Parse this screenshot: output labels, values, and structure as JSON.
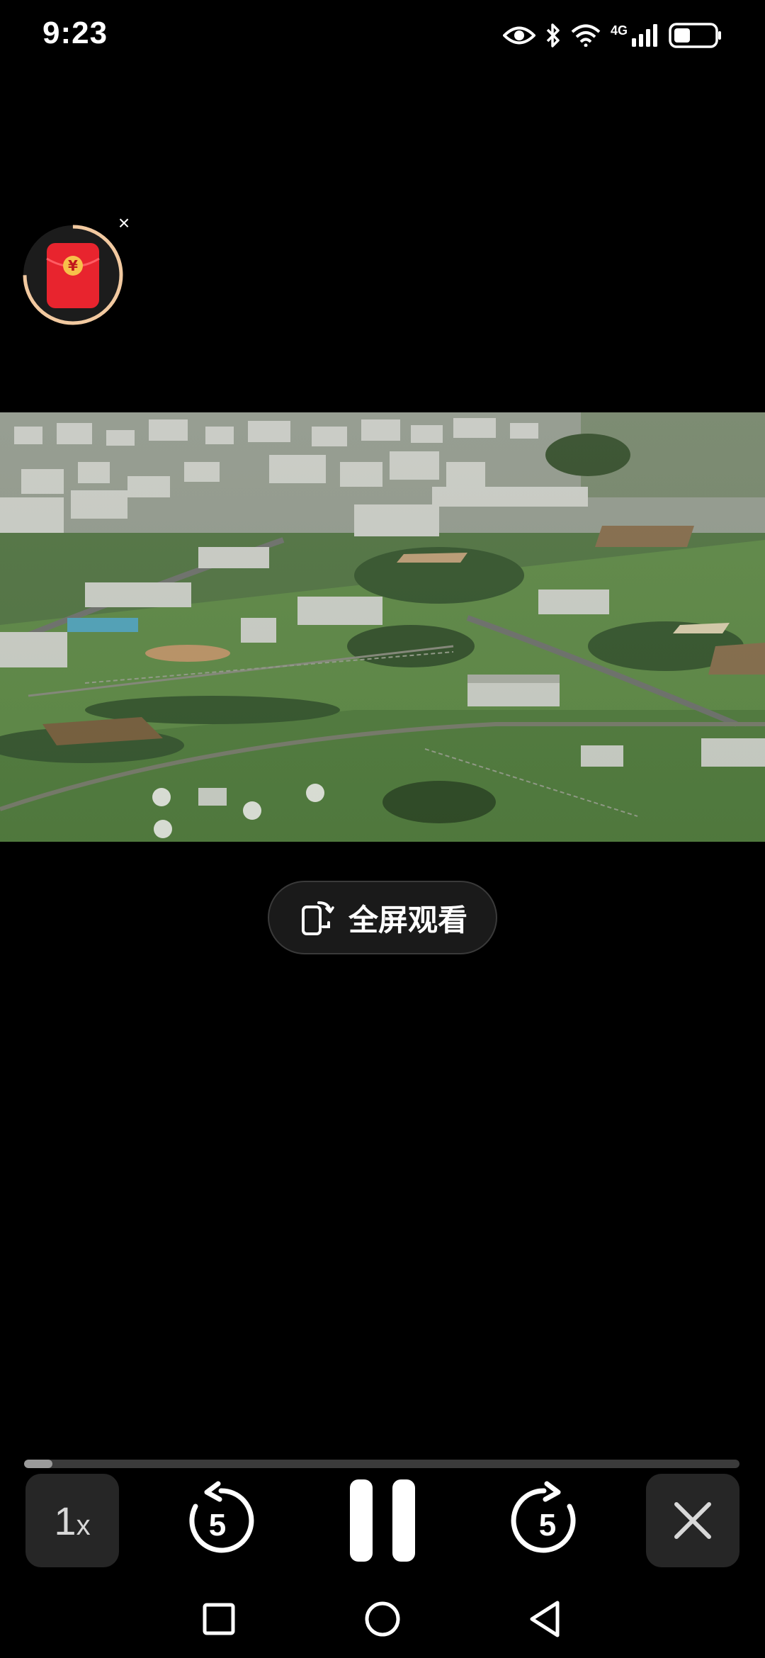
{
  "status_bar": {
    "time": "9:23",
    "network": "4G",
    "icons": [
      "eye-icon",
      "bluetooth-icon",
      "wifi-icon",
      "signal-icon",
      "battery-icon"
    ],
    "battery_level": 0.4
  },
  "widget": {
    "red_packet_icon": "red-envelope-icon",
    "red_packet_symbol": "¥",
    "close_label": "×",
    "ring_progress": 0.75
  },
  "video": {
    "content": "aerial-base-footage",
    "fullscreen_label": "全屏观看",
    "fullscreen_icon": "rotate-screen-icon"
  },
  "player": {
    "progress": 0.04,
    "speed_label": "1",
    "speed_suffix": "x",
    "rewind_seconds": "5",
    "forward_seconds": "5",
    "rewind_icon": "rewind-icon",
    "forward_icon": "forward-icon",
    "pause_icon": "pause-icon",
    "close_icon": "close-icon"
  },
  "nav": {
    "recents_icon": "square-icon",
    "home_icon": "circle-icon",
    "back_icon": "triangle-back-icon"
  },
  "colors": {
    "background": "#000000",
    "red_packet": "#e8242e",
    "ring": "#f2c9a0",
    "control_bg": "#262626"
  }
}
